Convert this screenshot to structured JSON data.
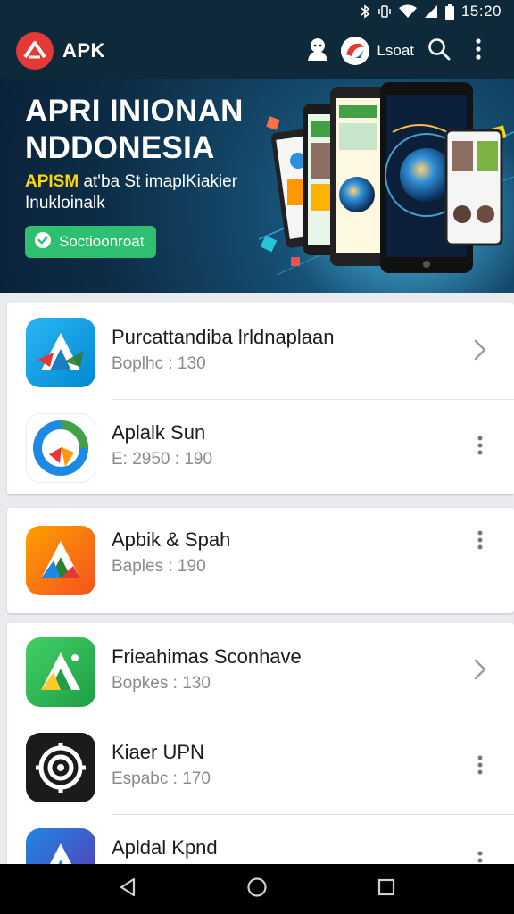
{
  "status_bar": {
    "time": "15:20",
    "icons": [
      "bluetooth-icon",
      "vibrate-icon",
      "wifi-icon",
      "signal-icon",
      "battery-icon"
    ]
  },
  "app_bar": {
    "brand": "APK",
    "user_label": "Lsoat",
    "icons": [
      "profile-icon",
      "search-icon",
      "overflow-menu-icon"
    ]
  },
  "banner": {
    "title_line1": "APRI INIONAN",
    "title_line2": "NDDONESIA",
    "subtitle_highlight": "APISM",
    "subtitle_rest": " at'ba St imaplKiakier",
    "subtitle_line2": "Inukloinalk",
    "cta_label": "Soctioonroat"
  },
  "cards": [
    {
      "apps": [
        {
          "name": "Purcattandiba lrldnaplaan",
          "meta": "Boplhc : 130",
          "action": "chevron-right-icon",
          "icon": "triangle-a-blue"
        },
        {
          "name": "Aplalk Sun",
          "meta": "E: 2950 : 190",
          "action": "more-vert-icon",
          "icon": "circle-swirl"
        }
      ]
    },
    {
      "apps": [
        {
          "name": "Apbik & Spah",
          "meta": "Baples : 190",
          "action": "more-vert-icon",
          "icon": "triangle-a-orange"
        }
      ]
    },
    {
      "apps": [
        {
          "name": "Frieahimas Sconhave",
          "meta": "Bopkes : 130",
          "action": "chevron-right-icon",
          "icon": "triangle-a-green"
        },
        {
          "name": "Kiaer UPN",
          "meta": "Espabc : 170",
          "action": "more-vert-icon",
          "icon": "target-black"
        },
        {
          "name": "Apldal Kpnd",
          "meta": "",
          "action": "more-vert-icon",
          "icon": "triangle-a-multicolor"
        }
      ]
    }
  ],
  "nav_bar": {
    "buttons": [
      "back-icon",
      "home-icon",
      "recents-icon"
    ]
  },
  "colors": {
    "app_bar": "#0e2a3a",
    "accent_green": "#2fbf71",
    "brand_red": "#e53935",
    "highlight_yellow": "#ffd600"
  }
}
